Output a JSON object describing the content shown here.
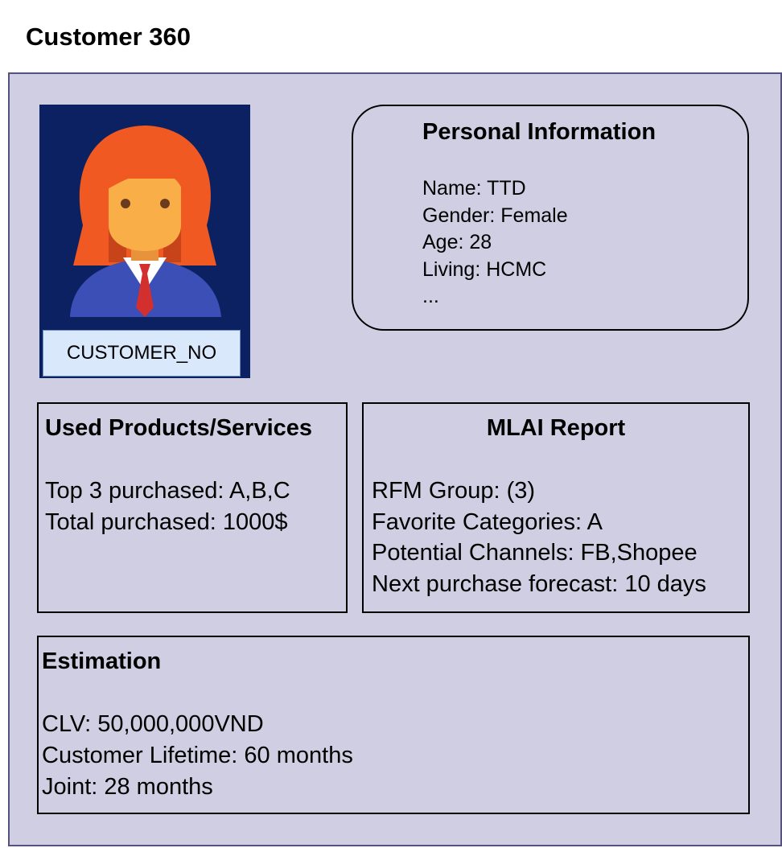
{
  "page": {
    "title": "Customer 360"
  },
  "avatar": {
    "icon": "female-customer-icon",
    "label": "CUSTOMER_NO"
  },
  "personal_info": {
    "title": "Personal Information",
    "lines": [
      "Name: TTD",
      "Gender: Female",
      "Age: 28",
      "Living: HCMC",
      "..."
    ]
  },
  "used_products": {
    "title": "Used Products/Services",
    "lines": [
      "Top 3 purchased: A,B,C",
      "Total purchased: 1000$"
    ]
  },
  "mlai_report": {
    "title": "MLAI Report",
    "lines": [
      "RFM Group: (3)",
      "Favorite Categories: A",
      "Potential Channels: FB,Shopee",
      "Next purchase forecast: 10 days"
    ]
  },
  "estimation": {
    "title": "Estimation",
    "lines": [
      "CLV: 50,000,000VND",
      "Customer Lifetime: 60 months",
      "Joint: 28 months"
    ]
  },
  "colors": {
    "canvas_fill": "#d0cee2",
    "canvas_border": "#56517e",
    "avatar_background": "#0c2161",
    "label_fill": "#dae8fc",
    "label_border": "#6c8ebf"
  }
}
